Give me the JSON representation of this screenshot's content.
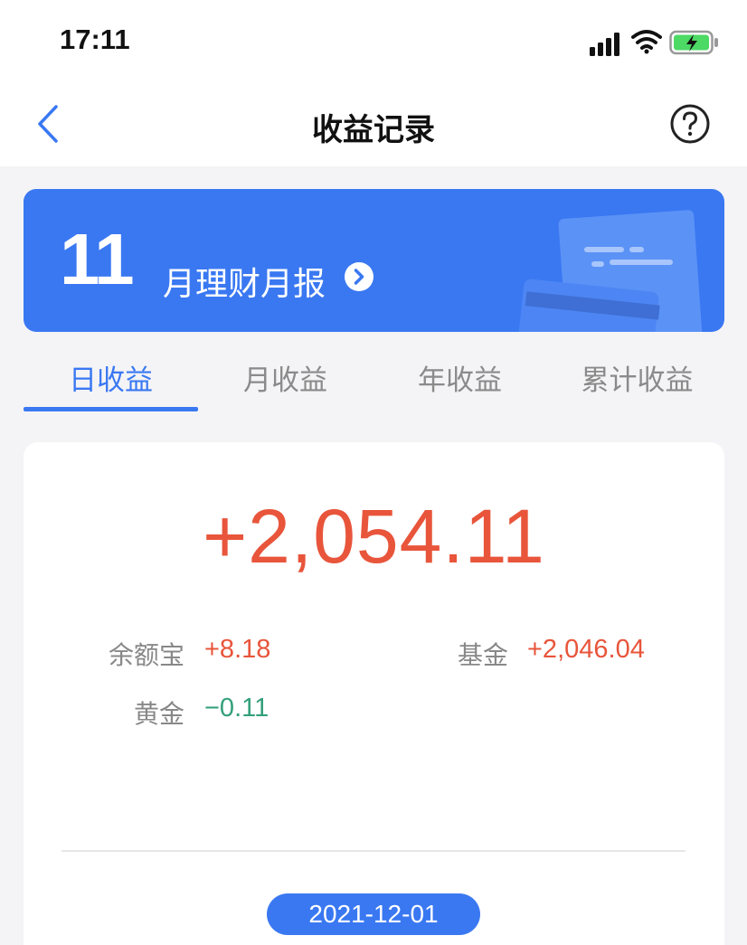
{
  "status_bar": {
    "time": "17:11",
    "icons": [
      "signal-icon",
      "wifi-icon",
      "battery-charging-icon"
    ]
  },
  "nav": {
    "title": "收益记录",
    "back_icon": "chevron-left-icon",
    "help_icon": "question-circle-icon"
  },
  "banner": {
    "month": "11",
    "text": "月理财月报",
    "arrow_icon": "chevron-right-circle-icon"
  },
  "tabs": [
    {
      "label": "日收益",
      "active": true
    },
    {
      "label": "月收益",
      "active": false
    },
    {
      "label": "年收益",
      "active": false
    },
    {
      "label": "累计收益",
      "active": false
    }
  ],
  "summary": {
    "total": "+2,054.11",
    "items": [
      {
        "label": "余额宝",
        "value": "+8.18",
        "trend": "up"
      },
      {
        "label": "基金",
        "value": "+2,046.04",
        "trend": "up"
      },
      {
        "label": "黄金",
        "value": "−0.11",
        "trend": "down"
      }
    ],
    "date": "2021-12-01"
  },
  "colors": {
    "accent": "#3a78f2",
    "gain": "#e8553b",
    "loss": "#33a07a",
    "background": "#f4f4f6"
  }
}
